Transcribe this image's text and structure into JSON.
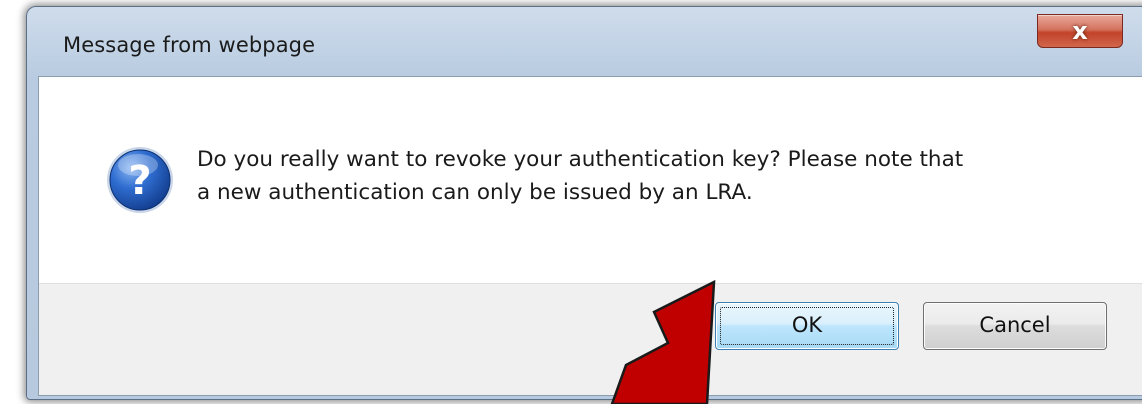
{
  "dialog": {
    "title": "Message from webpage",
    "close_glyph": "x",
    "icon": "question-icon",
    "icon_glyph": "?",
    "message_lines": [
      "Do you really want to revoke your authentication key? Please note that",
      "a new authentication can only be issued by an LRA."
    ],
    "buttons": {
      "ok_label": "OK",
      "cancel_label": "Cancel"
    }
  },
  "annotation": {
    "icon": "arrow-icon",
    "color": "#c00000"
  },
  "colors": {
    "title_bar": "#c2d3e6",
    "close_button": "#c2432a",
    "button_bar": "#f0f0f0",
    "ok_button_border": "#3c7fb1",
    "icon_blue": "#1f56b8"
  }
}
